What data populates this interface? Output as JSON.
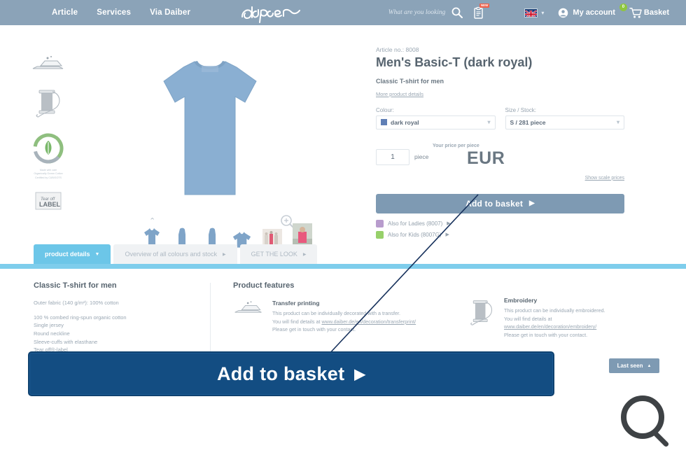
{
  "header": {
    "nav": [
      {
        "label": "Article"
      },
      {
        "label": "Services"
      },
      {
        "label": "Via Daiber"
      }
    ],
    "logo_text": "daiber",
    "search_placeholder": "What are you looking",
    "search_icon": "search-icon",
    "notes_icon": "clipboard-icon",
    "notes_badge": "NEW",
    "language_flag": "uk-flag-icon",
    "account_label": "My account",
    "account_icon": "user-icon",
    "basket_label": "Basket",
    "basket_icon": "cart-icon",
    "basket_count": "0"
  },
  "rail": {
    "items": [
      {
        "icon": "transfer-print-icon",
        "caption": ""
      },
      {
        "icon": "embroidery-spool-icon",
        "caption": ""
      },
      {
        "icon": "organic-cotton-badge-icon",
        "caption": "Made with care\nOrganically Grown Cotton\nCertified by CUB/GOTS"
      },
      {
        "icon": "tear-off-label-icon",
        "caption": ""
      }
    ]
  },
  "gallery": {
    "main_image": "mens-basic-t-dark-royal-front",
    "zoom_icon": "zoom-in-icon",
    "scroll_up_icon": "chevron-up-icon",
    "thumbnails": [
      {
        "name": "thumb-front"
      },
      {
        "name": "thumb-side"
      },
      {
        "name": "thumb-back"
      },
      {
        "name": "thumb-detail"
      },
      {
        "name": "thumb-lifestyle-group"
      },
      {
        "name": "thumb-lifestyle-pink"
      }
    ]
  },
  "product": {
    "article_no": "Article no.: 8008",
    "title": "Men's Basic-T (dark royal)",
    "subtitle": "Classic T-shirt for men",
    "more_details_link": "More product details",
    "colour_label": "Colour:",
    "colour_value": "dark royal",
    "colour_swatch": "#5f7fb5",
    "size_label": "Size / Stock:",
    "size_value": "S / 281 piece",
    "quantity": "1",
    "quantity_unit": "piece",
    "price_label": "Your price per piece",
    "price_value": "EUR",
    "scale_prices_link": "Show scale prices",
    "add_to_basket": "Add to basket",
    "also_ladies": "Also for Ladies (8007)",
    "also_kids": "Also for Kids (8007G)",
    "also_ladies_color": "#b89ccd",
    "also_kids_color": "#97d06a"
  },
  "tabs": [
    {
      "label": "product details",
      "state": "active",
      "marker": "▼"
    },
    {
      "label": "Overview of all colours and stock",
      "state": "idle",
      "marker": "▶"
    },
    {
      "label": "GET THE LOOK",
      "state": "idle",
      "marker": "▶"
    }
  ],
  "details": {
    "heading": "Classic T-shirt for men",
    "fabric": "Outer fabric (140 g/m²): 100% cotton",
    "bullets": [
      "100 % combed ring-spun organic cotton",
      "Single jersey",
      "Round neckline",
      "Sleeve-cuffs with elasthane",
      "Tear off®-label"
    ]
  },
  "features": {
    "heading": "Product features",
    "transfer": {
      "icon": "transfer-print-icon",
      "title": "Transfer printing",
      "line1": "This product can be individually decorated with a transfer.",
      "line2_pre": "You will find details at ",
      "link": "www.daiber.de/en/decoration/transferprint/",
      "line3": "Please get in touch with your contact."
    },
    "embroidery": {
      "icon": "embroidery-spool-icon",
      "title": "Embroidery",
      "line1": "This product can be individually embroidered.",
      "line2_pre": "You will find details at",
      "link": "www.daiber.de/en/decoration/embroidery/",
      "line3": "Please get in touch with your contact."
    }
  },
  "last_seen": {
    "label": "Last seen",
    "marker": "▲"
  },
  "overlay": {
    "add_to_basket_big": "Add to basket",
    "arrow": "▶",
    "connector_color": "#17315c",
    "cursor_icon": "magnifier-cursor-icon"
  }
}
